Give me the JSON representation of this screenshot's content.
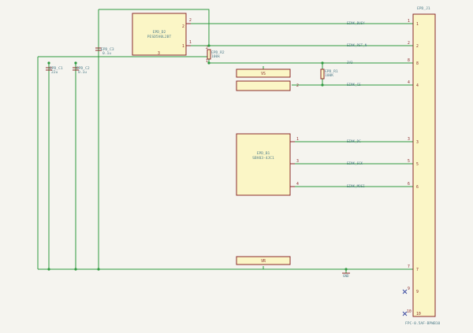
{
  "connector": {
    "ref": "EPD_J1",
    "value": "FPC-0.5AF-BPWB10",
    "pins": [
      "1",
      "2",
      "8",
      "4",
      "3",
      "5",
      "6",
      "7",
      "9",
      "10"
    ]
  },
  "u2": {
    "ref": "EPD_D2",
    "value": "PESD5V0L2BT",
    "pin2": "2",
    "pin1": "1",
    "pin3": "3"
  },
  "u1": {
    "ref": "EPD_B1",
    "value": "SBV03-4JC1",
    "pin1": "1",
    "pin3": "3",
    "pin4": "4"
  },
  "c3": {
    "ref": "EPD_C3",
    "value": "0.1u"
  },
  "c1": {
    "ref": "EPD_C1",
    "value": "22u"
  },
  "c2": {
    "ref": "EPD_C2",
    "value": "0.1u"
  },
  "r2": {
    "ref": "EPD_R2",
    "value": "100k",
    "pin2": "2",
    "pin1": "1"
  },
  "r1": {
    "ref": "EPD_R1",
    "value": "100K"
  },
  "small_blocks": [
    {
      "label": "VS",
      "pin": ""
    },
    {
      "label": "",
      "pin": "2"
    },
    {
      "label": "VR",
      "pin": ""
    }
  ],
  "nets": [
    "EINK_BUSY",
    "EINK_RST_N",
    "3V3",
    "EINK_CS",
    "EINK_DC",
    "EINK_SCK",
    "EINK_MOSI"
  ],
  "gnd_label": "GND"
}
